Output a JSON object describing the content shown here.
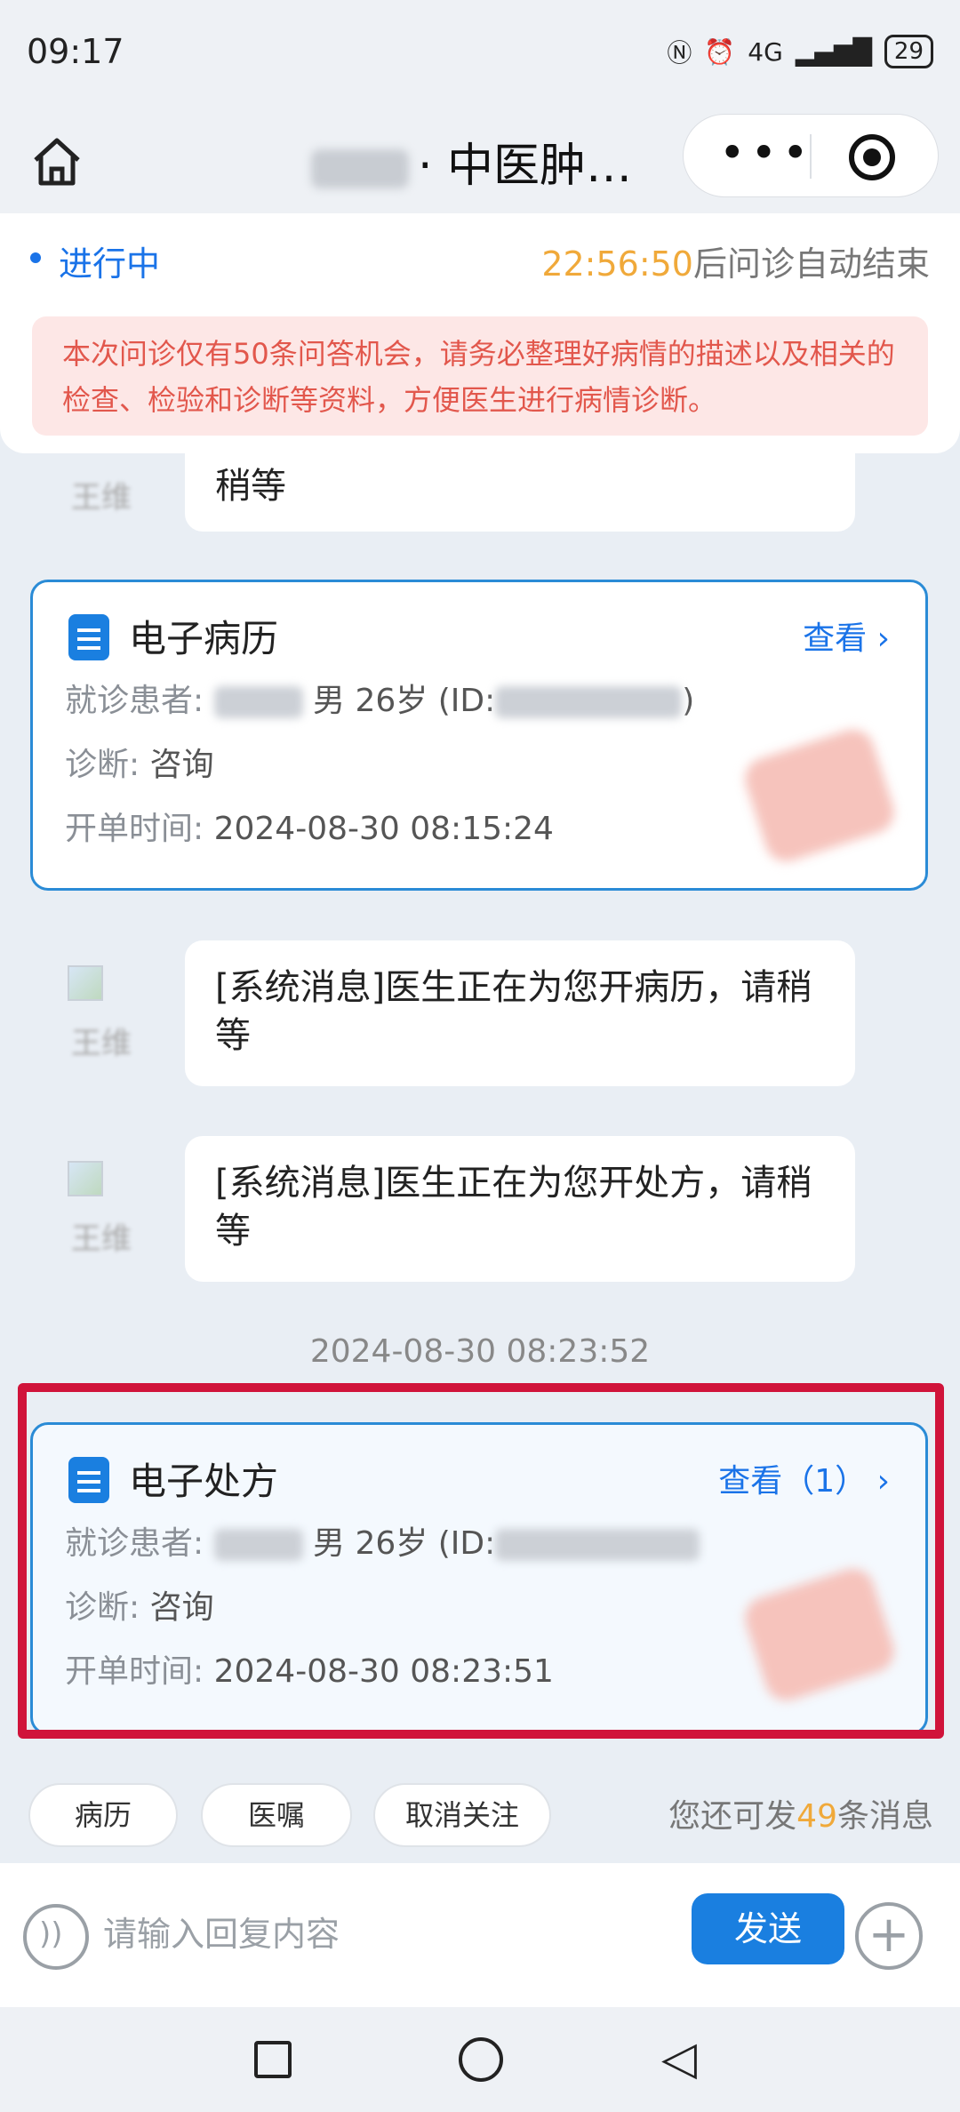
{
  "status_bar": {
    "time": "09:17",
    "network": "4G",
    "battery": "29"
  },
  "nav": {
    "title": "· 中医肿…",
    "more_icon": "more-dots-icon",
    "close_icon": "target-icon"
  },
  "consult": {
    "status": "进行中",
    "countdown": "22:56:50",
    "countdown_suffix": "后问诊自动结束",
    "notice": "本次问诊仅有50条问答机会，请务必整理好病情的描述以及相关的检查、检验和诊断等资料，方便医生进行病情诊断。"
  },
  "messages": [
    {
      "sender": "王维",
      "text": "稍等"
    },
    {
      "sender": "王维",
      "text": "[系统消息]医生正在为您开病历，请稍等"
    },
    {
      "sender": "王维",
      "text": "[系统消息]医生正在为您开处方，请稍等"
    }
  ],
  "record_card": {
    "title": "电子病历",
    "view_label": "查看",
    "patient_label": "就诊患者:",
    "patient_info": "男 26岁 (ID:",
    "diagnosis_label": "诊断:",
    "diagnosis_value": "咨询",
    "time_label": "开单时间:",
    "time_value": "2024-08-30 08:15:24"
  },
  "timestamp": "2024-08-30 08:23:52",
  "prescription_card": {
    "title": "电子处方",
    "view_label": "查看（1）",
    "patient_label": "就诊患者:",
    "patient_info": "男 26岁 (ID:",
    "diagnosis_label": "诊断:",
    "diagnosis_value": "咨询",
    "time_label": "开单时间:",
    "time_value": "2024-08-30 08:23:51"
  },
  "quick_actions": [
    "病历",
    "医嘱",
    "取消关注"
  ],
  "remaining": {
    "prefix": "您还可发",
    "count": "49",
    "suffix": "条消息"
  },
  "input": {
    "placeholder": "请输入回复内容",
    "send_label": "发送"
  },
  "colors": {
    "accent": "#1a73e8",
    "highlight": "#d0133a",
    "warn_text": "#e2574c",
    "timer": "#f0a93a"
  }
}
